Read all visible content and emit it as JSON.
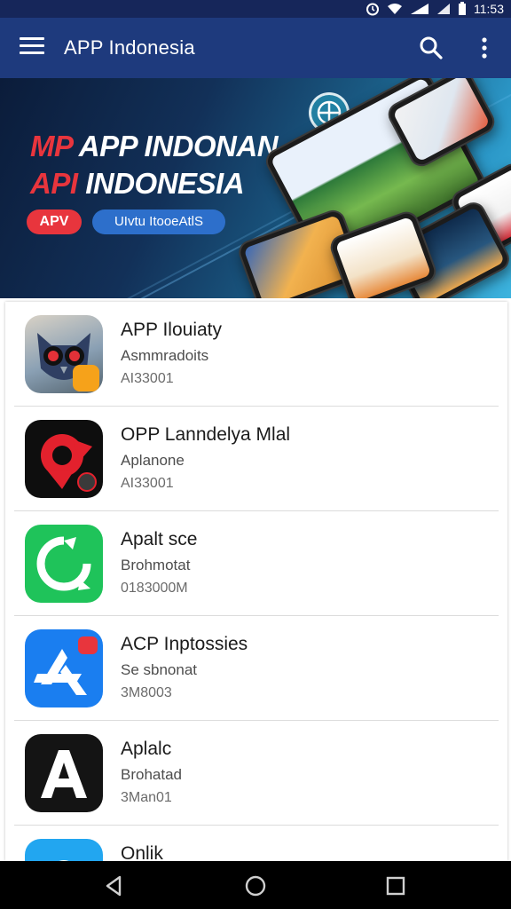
{
  "status_bar": {
    "time": "11:53"
  },
  "app_bar": {
    "title": "APP Indonesia"
  },
  "banner": {
    "line1_red": "MP",
    "line1_white": "APP INDONAN",
    "line2_red": "API",
    "line2_white": "INDONESIA",
    "pill_red": "APV",
    "pill_blue": "UIvtu ItooeAtlS",
    "colors": {
      "red": "#e8353d",
      "blue": "#2d6fcb"
    }
  },
  "apps": [
    {
      "name": "APP Ilouiaty",
      "subtitle": "Asmmradoits",
      "size": "AI33001",
      "icon": "owl-robot-icon"
    },
    {
      "name": "OPP Lanndelya Mlal",
      "subtitle": "Aplanone",
      "size": "AI33001",
      "icon": "red-pin-icon"
    },
    {
      "name": "Apalt  sce",
      "subtitle": "Brohmotat",
      "size": "0183000M",
      "icon": "green-refresh-icon"
    },
    {
      "name": "ACP Inptossies",
      "subtitle": "Se sbnonat",
      "size": "3M8003",
      "icon": "app-store-icon"
    },
    {
      "name": "Aplalc",
      "subtitle": "Brohatad",
      "size": "3Man01",
      "icon": "letter-a-icon"
    },
    {
      "name": "Onlik",
      "subtitle": "",
      "size": "",
      "icon": "blue-cloud-icon"
    }
  ],
  "theme": {
    "app_bar": "#1e3a7d",
    "status_bar": "#16265a"
  }
}
